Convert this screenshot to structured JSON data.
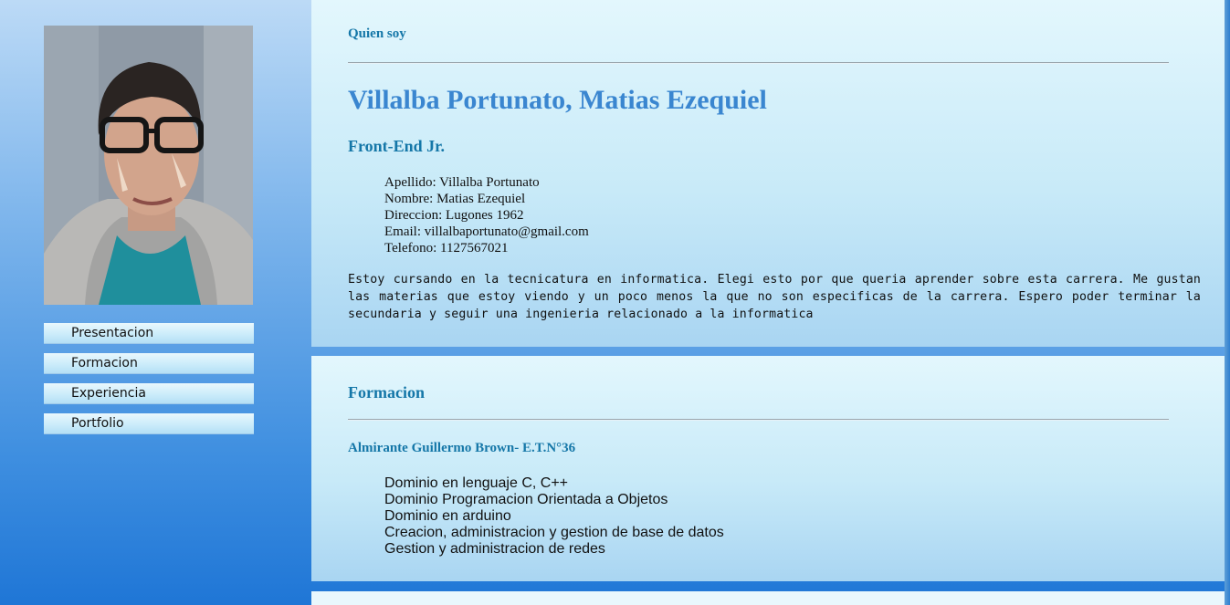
{
  "sidebar": {
    "photo": "profile-photo",
    "nav": [
      {
        "label": "Presentacion"
      },
      {
        "label": "Formacion"
      },
      {
        "label": "Experiencia"
      },
      {
        "label": "Portfolio"
      }
    ]
  },
  "about": {
    "title": "Quien soy",
    "name": "Villalba Portunato, Matias Ezequiel",
    "role": "Front-End Jr.",
    "details": [
      "Apellido: Villalba Portunato",
      "Nombre: Matias Ezequiel",
      "Direccion: Lugones 1962",
      "Email: villalbaportunato@gmail.com",
      "Telefono: 1127567021"
    ],
    "bio": "Estoy cursando en la tecnicatura en informatica. Elegi esto por que queria aprender sobre esta carrera. Me gustan las materias que estoy viendo y un poco menos la que no son especificas de la carrera. Espero poder terminar la secundaria y seguir una ingenieria relacionado a la informatica"
  },
  "education": {
    "title": "Formacion",
    "school": "Almirante Guillermo Brown- E.T.N°36",
    "skills": [
      "Dominio en lenguaje C, C++",
      "Dominio Programacion Orientada a Objetos",
      "Dominio en arduino",
      "Creacion, administracion y gestion de base de datos",
      "Gestion y administracion de redes"
    ]
  },
  "colors": {
    "accent": "#1577a8",
    "name": "#3a86d0",
    "background_top": "#bcdaf6",
    "background_bottom": "#1f76d6"
  }
}
